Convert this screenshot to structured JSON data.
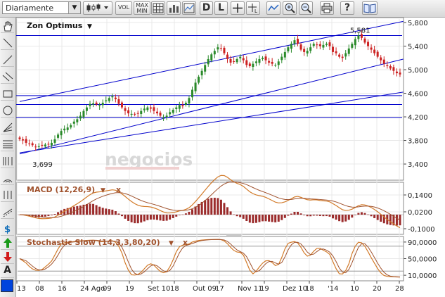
{
  "toolbar": {
    "period_select": "Diariamente",
    "vol_label": "VOL",
    "maxmin_label_1": "MAX",
    "maxmin_label_2": "MIN",
    "d_label": "D",
    "l_label": "L",
    "help_label": "?"
  },
  "colors": {
    "price_line": "#0000cc",
    "up_candle": "#2a8a2a",
    "down_candle": "#cc2222",
    "osc_line": "#d27a28",
    "osc_signal": "#a0522d",
    "hist": "#9b2b2b",
    "grid": "#e8e8e8"
  },
  "chart_data": [
    {
      "type": "line",
      "title": "Zon Optimus",
      "yticks": [
        "5,800",
        "5,400",
        "5,000",
        "4,600",
        "4,200",
        "3,800",
        "3,400"
      ],
      "ylim": [
        3.15,
        5.86
      ],
      "annotations": [
        {
          "label": "5,581",
          "value": 5.581
        },
        {
          "label": "3,699",
          "value": 3.699
        }
      ],
      "horizontal_levels": [
        5.58,
        4.56,
        4.41,
        4.19
      ],
      "channel_lines": [
        {
          "from": [
            0,
            4.46
          ],
          "to": [
            120,
            5.82
          ]
        },
        {
          "from": [
            0,
            3.57
          ],
          "to": [
            120,
            5.18
          ]
        },
        {
          "from": [
            0,
            3.59
          ],
          "to": [
            120,
            4.62
          ]
        }
      ],
      "x_tick_labels": [
        "13",
        "08",
        "16",
        "24 Ago",
        "09",
        "19",
        "Set 10",
        "18",
        "Out 09",
        "17",
        "Nov 11",
        "19",
        "Dez 10",
        "18",
        "'14",
        "10",
        "20",
        "28"
      ],
      "close": [
        3.82,
        3.8,
        3.76,
        3.74,
        3.72,
        3.69,
        3.7,
        3.71,
        3.73,
        3.74,
        3.76,
        3.82,
        3.9,
        3.96,
        4.0,
        4.02,
        4.06,
        4.12,
        4.16,
        4.22,
        4.3,
        4.36,
        4.42,
        4.43,
        4.41,
        4.4,
        4.44,
        4.48,
        4.52,
        4.55,
        4.5,
        4.42,
        4.36,
        4.3,
        4.26,
        4.25,
        4.24,
        4.26,
        4.3,
        4.34,
        4.36,
        4.34,
        4.3,
        4.26,
        4.22,
        4.2,
        4.22,
        4.28,
        4.32,
        4.36,
        4.4,
        4.38,
        4.44,
        4.52,
        4.66,
        4.78,
        4.88,
        4.98,
        5.08,
        5.18,
        5.26,
        5.32,
        5.38,
        5.36,
        5.28,
        5.18,
        5.12,
        5.14,
        5.18,
        5.22,
        5.16,
        5.08,
        5.06,
        5.1,
        5.14,
        5.18,
        5.2,
        5.16,
        5.12,
        5.1,
        5.08,
        5.14,
        5.22,
        5.3,
        5.38,
        5.44,
        5.5,
        5.44,
        5.34,
        5.3,
        5.32,
        5.38,
        5.44,
        5.42,
        5.4,
        5.42,
        5.44,
        5.4,
        5.3,
        5.28,
        5.22,
        5.2,
        5.28,
        5.36,
        5.44,
        5.52,
        5.58,
        5.54,
        5.46,
        5.4,
        5.34,
        5.28,
        5.22,
        5.16,
        5.1,
        5.06,
        5.02,
        4.98,
        4.94,
        4.92
      ]
    },
    {
      "type": "line",
      "title": "MACD (12,26,9)",
      "yticks": [
        "0,1400",
        "0,0200",
        "-0,1000"
      ],
      "ylim": [
        -0.13,
        0.22
      ]
    },
    {
      "type": "line",
      "title": "Stochastic Slow (14,3,3,80,20)",
      "yticks": [
        "90,0000",
        "50,0000",
        "10,0000"
      ],
      "ylim": [
        0,
        100
      ],
      "levels": [
        80,
        20
      ]
    }
  ],
  "watermark": "negocios"
}
